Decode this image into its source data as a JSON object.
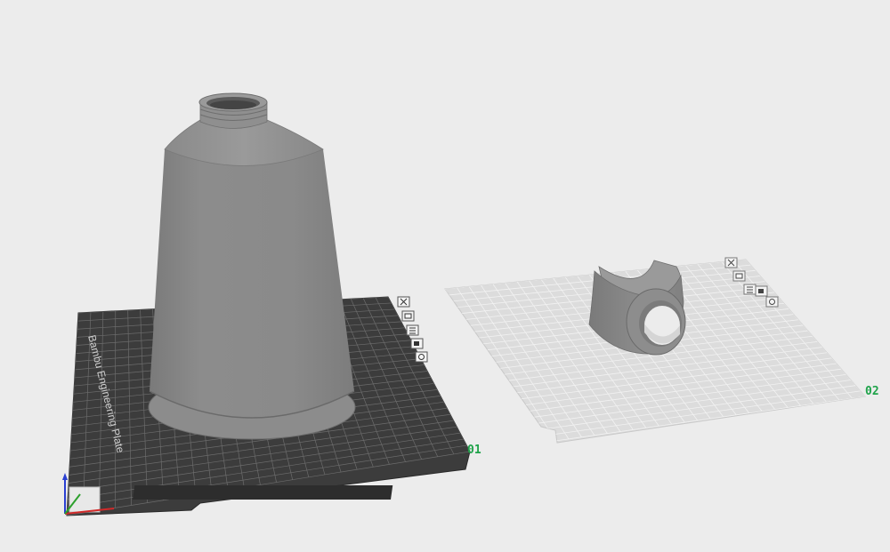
{
  "viewport": {
    "background": "#ececec",
    "accent_color": "#1fa34a"
  },
  "plates": [
    {
      "label": "01",
      "name": "Bambu Engineering Plate",
      "surface_color": "#3c3c3c",
      "icons": [
        "close-icon",
        "arrange-icon",
        "orient-icon",
        "lock-icon",
        "settings-icon"
      ]
    },
    {
      "label": "02",
      "surface_color": "#dcdcdc",
      "icons": [
        "close-icon",
        "arrange-icon",
        "orient-icon",
        "lock-icon",
        "settings-icon"
      ]
    }
  ],
  "objects": [
    {
      "name": "cone-bottle",
      "color": "#8a8a8a"
    },
    {
      "name": "ring-clip",
      "color": "#8a8a8a"
    }
  ],
  "axes": {
    "x_color": "#d22a2a",
    "y_color": "#2ca02c",
    "z_color": "#2a3fd2"
  }
}
